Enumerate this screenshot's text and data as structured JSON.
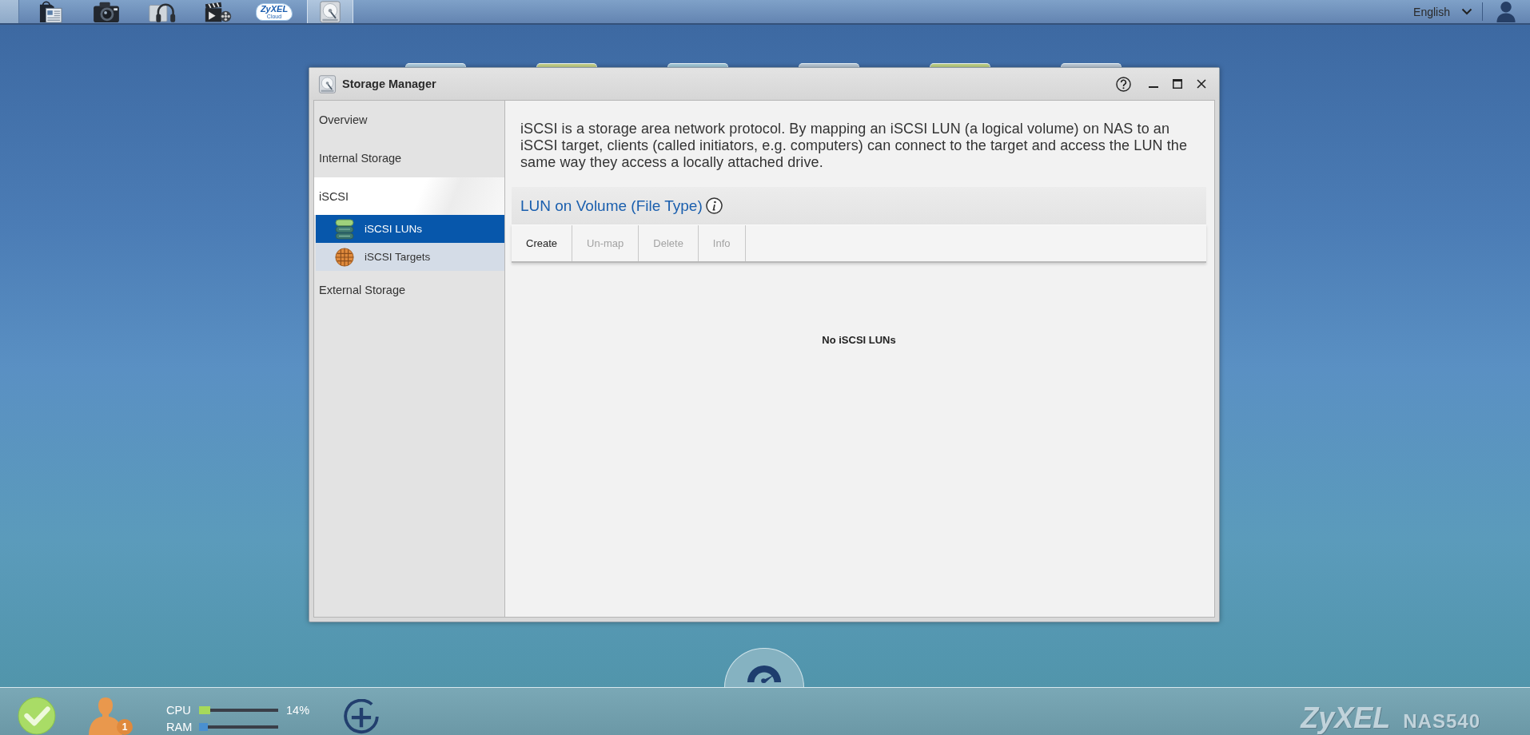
{
  "taskbar": {
    "apps": [
      {
        "kind": "news",
        "selected": false
      },
      {
        "kind": "photo",
        "selected": false
      },
      {
        "kind": "music",
        "selected": false
      },
      {
        "kind": "video",
        "selected": false
      },
      {
        "kind": "cloud",
        "label": "ZyXEL",
        "sublabel": "Cloud",
        "selected": false
      },
      {
        "kind": "storage",
        "selected": true
      }
    ],
    "language": "English"
  },
  "desktop_icons": [
    {
      "color": "#b4d3e6"
    },
    {
      "color": "#cdd98e"
    },
    {
      "color": "#a9d0e0"
    },
    {
      "color": "#bfcfdc"
    },
    {
      "color": "#c6d98a"
    },
    {
      "color": "#c4d1de"
    }
  ],
  "window": {
    "title": "Storage Manager"
  },
  "sidebar": {
    "items": [
      {
        "label": "Overview",
        "selected": false
      },
      {
        "label": "Internal Storage",
        "selected": false
      },
      {
        "label": "iSCSI",
        "selected": false,
        "expanded": true,
        "children": [
          {
            "label": "iSCSI LUNs",
            "kind": "luns",
            "selected": true
          },
          {
            "label": "iSCSI Targets",
            "kind": "targets",
            "selected": false
          }
        ]
      },
      {
        "label": "External Storage",
        "selected": false
      }
    ]
  },
  "content": {
    "description": "iSCSI is a storage area network protocol. By mapping an iSCSI LUN (a logical volume) on NAS to an iSCSI target, clients (called initiators, e.g. computers) can connect to the target and access the LUN the same way they access a locally attached drive.",
    "section_title": "LUN on Volume (File Type)",
    "toolbar": [
      {
        "label": "Create",
        "disabled": false
      },
      {
        "label": "Un-map",
        "disabled": true
      },
      {
        "label": "Delete",
        "disabled": true
      },
      {
        "label": "Info",
        "disabled": true
      }
    ],
    "empty_message": "No iSCSI LUNs"
  },
  "status_bar": {
    "users_badge": "1",
    "meters": [
      {
        "label": "CPU",
        "level": 0.14,
        "color": "#a6d95a",
        "reading": "14%"
      },
      {
        "label": "RAM",
        "level": 0.11,
        "color": "#4a90d0"
      }
    ],
    "logo": {
      "brand": "ZyXEL",
      "model": "NAS540"
    }
  }
}
